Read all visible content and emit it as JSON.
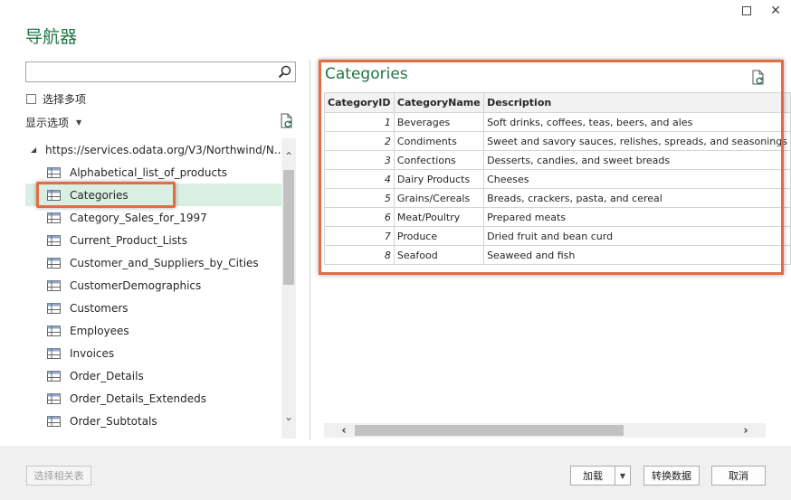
{
  "window": {
    "title": "导航器"
  },
  "left": {
    "search": {
      "value": "",
      "placeholder": ""
    },
    "multi_select_label": "选择多项",
    "display_options_label": "显示选项",
    "tree_root_label": "https://services.odata.org/V3/Northwind/N...",
    "items": [
      {
        "label": "Alphabetical_list_of_products"
      },
      {
        "label": "Categories"
      },
      {
        "label": "Category_Sales_for_1997"
      },
      {
        "label": "Current_Product_Lists"
      },
      {
        "label": "Customer_and_Suppliers_by_Cities"
      },
      {
        "label": "CustomerDemographics"
      },
      {
        "label": "Customers"
      },
      {
        "label": "Employees"
      },
      {
        "label": "Invoices"
      },
      {
        "label": "Order_Details"
      },
      {
        "label": "Order_Details_Extendeds"
      },
      {
        "label": "Order_Subtotals"
      }
    ],
    "selected_item": "Categories"
  },
  "preview": {
    "title": "Categories",
    "columns": [
      "CategoryID",
      "CategoryName",
      "Description"
    ],
    "rows": [
      [
        "1",
        "Beverages",
        "Soft drinks, coffees, teas, beers, and ales"
      ],
      [
        "2",
        "Condiments",
        "Sweet and savory sauces, relishes, spreads, and seasonings"
      ],
      [
        "3",
        "Confections",
        "Desserts, candies, and sweet breads"
      ],
      [
        "4",
        "Dairy Products",
        "Cheeses"
      ],
      [
        "5",
        "Grains/Cereals",
        "Breads, crackers, pasta, and cereal"
      ],
      [
        "6",
        "Meat/Poultry",
        "Prepared meats"
      ],
      [
        "7",
        "Produce",
        "Dried fruit and bean curd"
      ],
      [
        "8",
        "Seafood",
        "Seaweed and fish"
      ]
    ]
  },
  "footer": {
    "select_related": "选择相关表",
    "load": "加载",
    "transform": "转换数据",
    "cancel": "取消"
  },
  "colors": {
    "accent": "#217346",
    "highlight": "#e46c42",
    "selected_bg": "#d9efe3"
  }
}
